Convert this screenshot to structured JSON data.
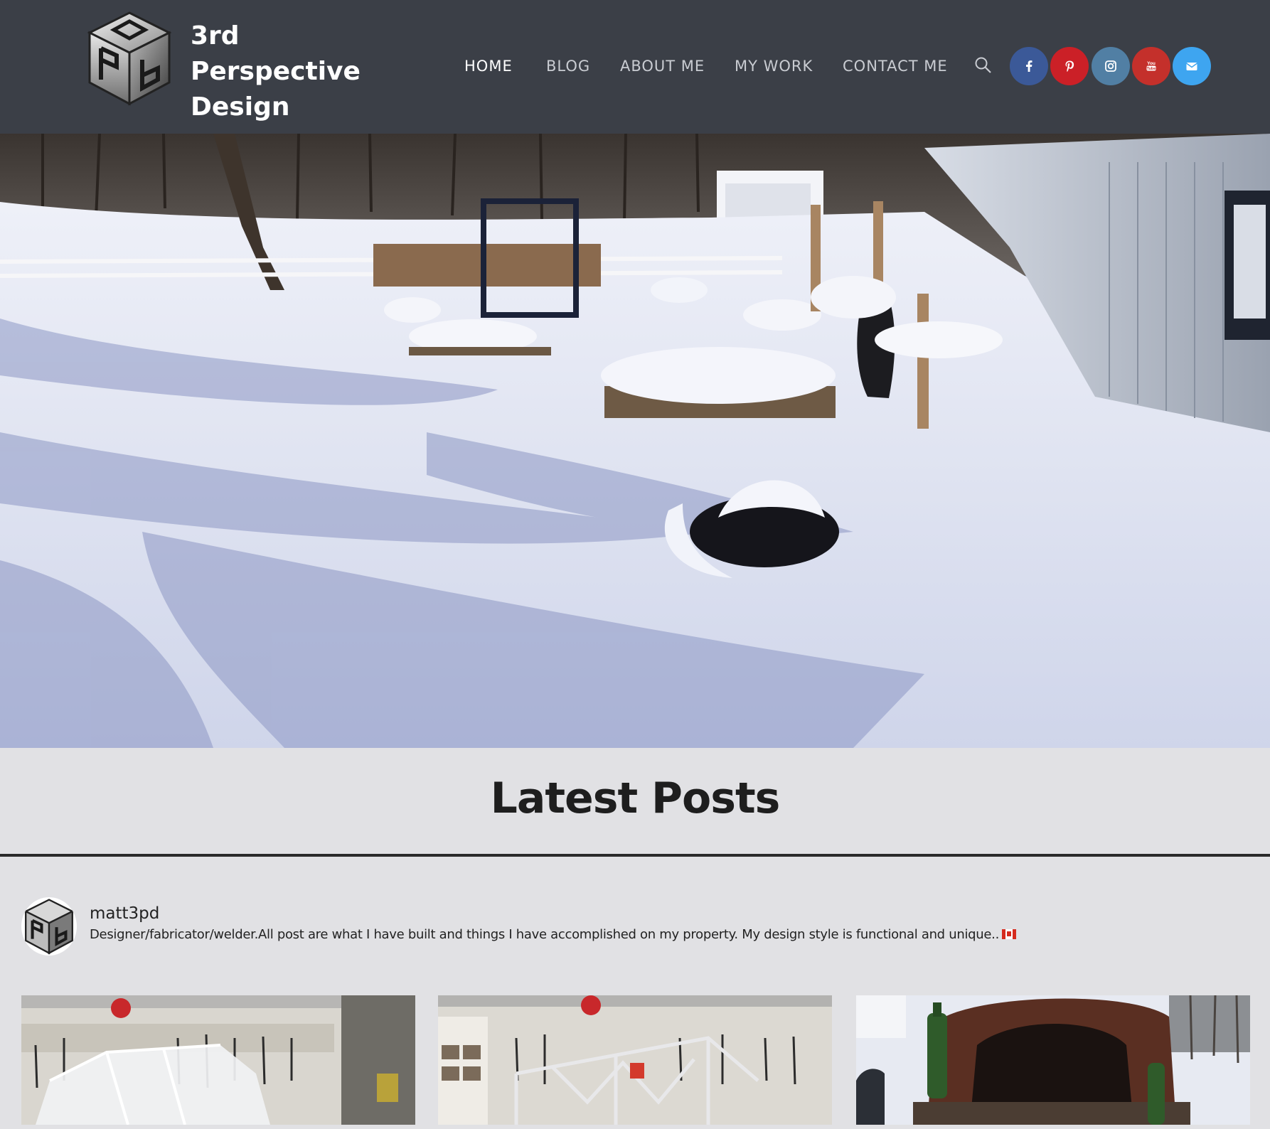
{
  "header": {
    "site_title": "3rd Perspective Design",
    "nav": [
      {
        "label": "HOME",
        "active": true
      },
      {
        "label": "BLOG",
        "active": false
      },
      {
        "label": "ABOUT ME",
        "active": false
      },
      {
        "label": "MY WORK",
        "active": false
      },
      {
        "label": "CONTACT ME",
        "active": false
      }
    ],
    "search_icon": "search-icon",
    "social": [
      {
        "name": "facebook",
        "icon": "facebook-icon",
        "color": "#3b5998"
      },
      {
        "name": "pinterest",
        "icon": "pinterest-icon",
        "color": "#cb2027"
      },
      {
        "name": "instagram",
        "icon": "instagram-icon",
        "color": "#517fa4"
      },
      {
        "name": "youtube",
        "icon": "youtube-icon",
        "color": "#c4302b"
      },
      {
        "name": "email",
        "icon": "envelope-icon",
        "color": "#3ea5f0"
      }
    ]
  },
  "hero": {
    "image": "snowy-backyard-photo"
  },
  "latest_posts": {
    "title": "Latest Posts",
    "profile": {
      "username": "matt3pd",
      "bio": "Designer/fabricator/welder.All post are what I have built and things I have accomplished on my property. My design style is functional and unique.."
    },
    "posts": [
      {
        "image": "greenhouse-frame-in-workshop"
      },
      {
        "image": "metal-frame-in-workshop"
      },
      {
        "image": "outdoor-pizza-oven"
      }
    ]
  },
  "colors": {
    "header_bg": "#3b3f47",
    "page_bg": "#e1e1e4",
    "nav_text": "#c9ccd2",
    "title_text": "#1e1e1e"
  }
}
